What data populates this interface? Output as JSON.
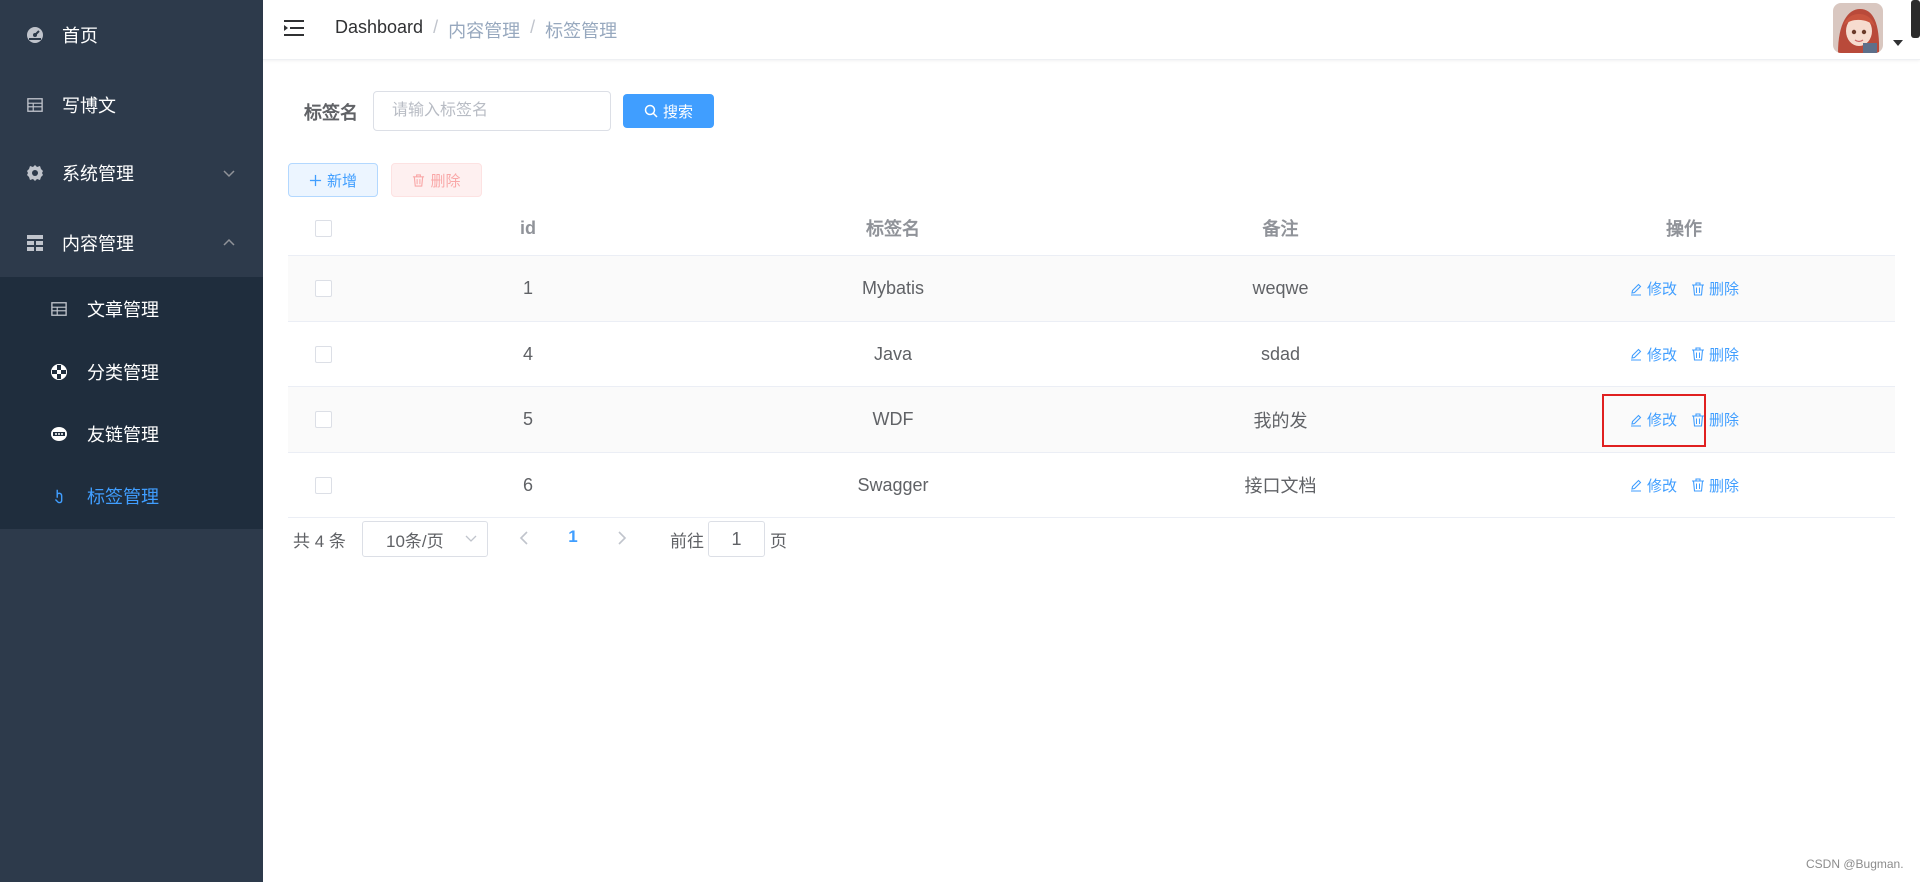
{
  "sidebar": {
    "items": [
      {
        "label": "首页",
        "icon": "dashboard-icon"
      },
      {
        "label": "写博文",
        "icon": "table-icon"
      },
      {
        "label": "系统管理",
        "icon": "gear-icon",
        "expanded": false
      },
      {
        "label": "内容管理",
        "icon": "grid-icon",
        "expanded": true
      }
    ],
    "submenu": [
      {
        "label": "文章管理",
        "icon": "table-icon"
      },
      {
        "label": "分类管理",
        "icon": "category-icon"
      },
      {
        "label": "友链管理",
        "icon": "link-badge-icon"
      },
      {
        "label": "标签管理",
        "icon": "tag-icon",
        "active": true
      }
    ]
  },
  "header": {
    "breadcrumb": [
      "Dashboard",
      "内容管理",
      "标签管理"
    ],
    "separator": "/"
  },
  "search": {
    "label": "标签名",
    "placeholder": "请输入标签名",
    "value": "",
    "button": "搜索"
  },
  "toolbar": {
    "add_label": "新增",
    "delete_label": "删除"
  },
  "table": {
    "columns": [
      "id",
      "标签名",
      "备注",
      "操作"
    ],
    "rows": [
      {
        "id": "1",
        "name": "Mybatis",
        "remark": "weqwe"
      },
      {
        "id": "4",
        "name": "Java",
        "remark": "sdad"
      },
      {
        "id": "5",
        "name": "WDF",
        "remark": "我的发"
      },
      {
        "id": "6",
        "name": "Swagger",
        "remark": "接口文档"
      }
    ],
    "edit_label": "修改",
    "delete_label": "删除"
  },
  "pagination": {
    "total_text": "共 4 条",
    "page_size": "10条/页",
    "current_page": "1",
    "goto_prefix": "前往",
    "goto_value": "1",
    "goto_suffix": "页"
  },
  "watermark": "CSDN @Bugman.",
  "colors": {
    "sidebar_bg": "#2d3a4b",
    "submenu_bg": "#1f2d3d",
    "accent": "#409eff",
    "danger_light": "#fef0f0",
    "highlight": "#e02020"
  }
}
